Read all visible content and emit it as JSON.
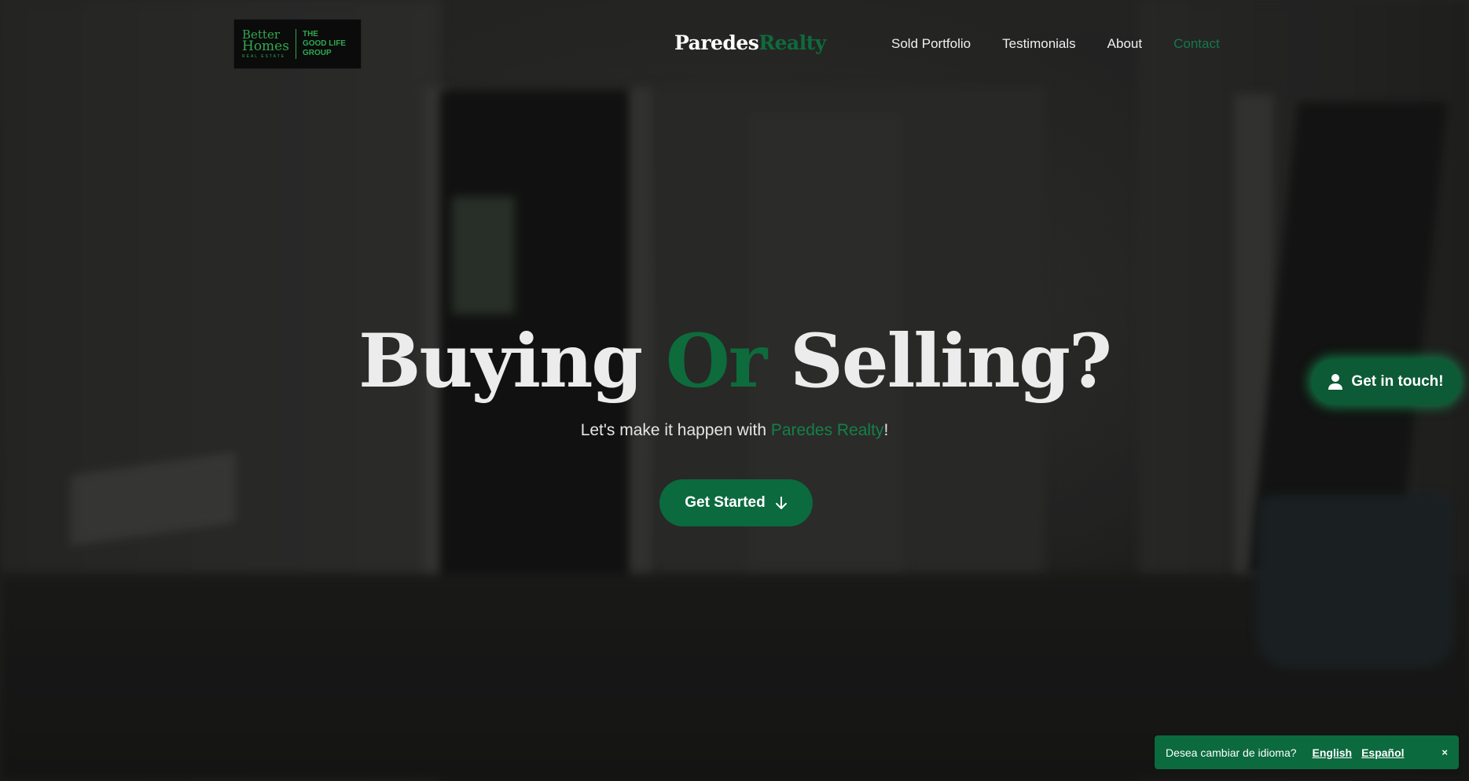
{
  "logo": {
    "left_line1": "Better",
    "left_line2": "Homes",
    "left_sub": "REAL ESTATE",
    "right_line1": "THE",
    "right_line2": "GOOD LIFE",
    "right_line3": "GROUP"
  },
  "brand": {
    "part1": "Paredes",
    "part2": "Realty"
  },
  "nav": {
    "items": [
      {
        "label": "Sold Portfolio"
      },
      {
        "label": "Testimonials"
      },
      {
        "label": "About"
      },
      {
        "label": "Contact"
      }
    ]
  },
  "hero": {
    "title_part1": "Buying ",
    "title_accent": "Or",
    "title_part2": " Selling?",
    "sub_prefix": "Let's make it happen with ",
    "sub_accent": "Paredes Realty",
    "sub_suffix": "!",
    "cta_label": "Get Started",
    "cta_icon": "arrow-down-icon"
  },
  "contact_float": {
    "label": "Get in touch!",
    "icon": "user-icon"
  },
  "language_bar": {
    "question": "Desea cambiar de idioma?",
    "english": "English",
    "spanish": "Español",
    "close": "×"
  },
  "colors": {
    "accent": "#0b6a3e",
    "accent_text": "#14784a",
    "logo_green": "#2fa84f",
    "background": "#1f201f"
  }
}
